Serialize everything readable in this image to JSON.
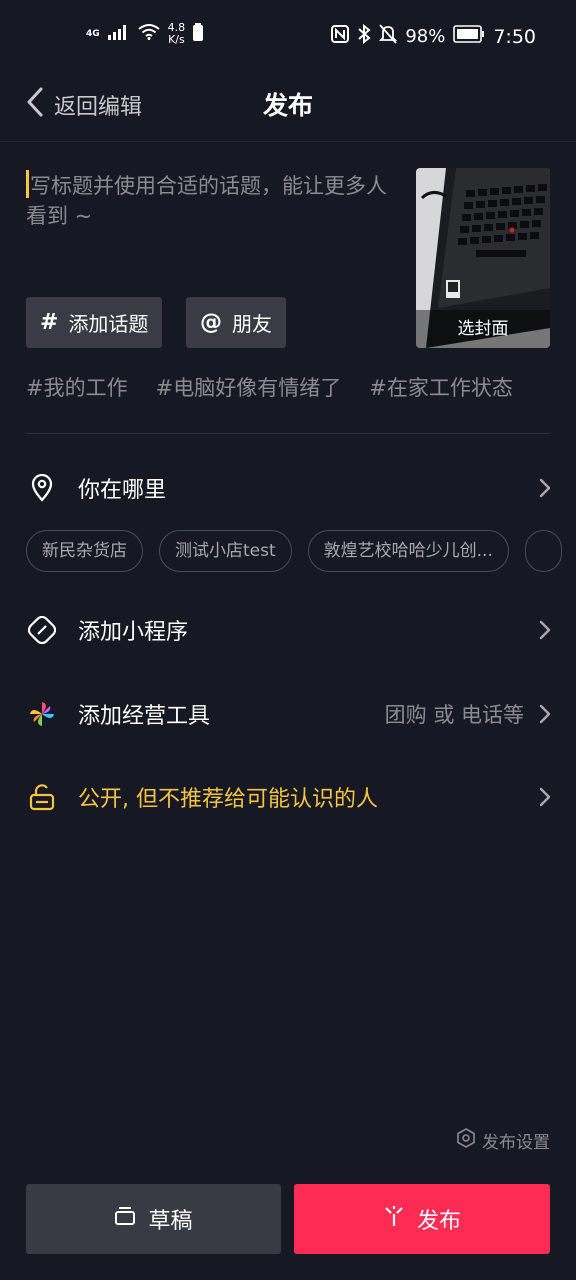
{
  "status_bar": {
    "network": "4G",
    "speed_value": "4.8",
    "speed_unit": "K/s",
    "battery": "98%",
    "time": "7:50"
  },
  "header": {
    "back_label": "返回编辑",
    "title": "发布"
  },
  "caption": {
    "placeholder": "写标题并使用合适的话题，能让更多人看到 ~"
  },
  "cover": {
    "label": "选封面"
  },
  "tools": {
    "topic_symbol": "#",
    "topic_label": "添加话题",
    "friend_symbol": "@",
    "friend_label": "朋友"
  },
  "hashtags": [
    "#我的工作",
    "#电脑好像有情绪了",
    "#在家工作状态"
  ],
  "location": {
    "label": "你在哪里",
    "suggestions": [
      "新民杂货店",
      "测试小店test",
      "敦煌艺校哈哈少儿创..."
    ]
  },
  "mini_program": {
    "label": "添加小程序"
  },
  "business_tools": {
    "label": "添加经营工具",
    "hint": "团购 或 电话等"
  },
  "privacy": {
    "label": "公开, 但不推荐给可能认识的人",
    "color": "#f5c542"
  },
  "footer": {
    "settings_label": "发布设置",
    "draft_label": "草稿",
    "publish_label": "发布",
    "publish_color": "#fe2c55"
  }
}
